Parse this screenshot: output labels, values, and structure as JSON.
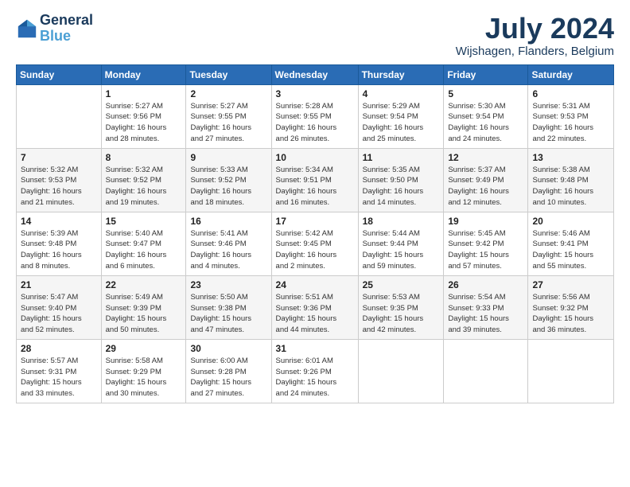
{
  "header": {
    "logo_line1": "General",
    "logo_line2": "Blue",
    "month_year": "July 2024",
    "location": "Wijshagen, Flanders, Belgium"
  },
  "weekdays": [
    "Sunday",
    "Monday",
    "Tuesday",
    "Wednesday",
    "Thursday",
    "Friday",
    "Saturday"
  ],
  "weeks": [
    [
      {
        "day": "",
        "info": ""
      },
      {
        "day": "1",
        "info": "Sunrise: 5:27 AM\nSunset: 9:56 PM\nDaylight: 16 hours\nand 28 minutes."
      },
      {
        "day": "2",
        "info": "Sunrise: 5:27 AM\nSunset: 9:55 PM\nDaylight: 16 hours\nand 27 minutes."
      },
      {
        "day": "3",
        "info": "Sunrise: 5:28 AM\nSunset: 9:55 PM\nDaylight: 16 hours\nand 26 minutes."
      },
      {
        "day": "4",
        "info": "Sunrise: 5:29 AM\nSunset: 9:54 PM\nDaylight: 16 hours\nand 25 minutes."
      },
      {
        "day": "5",
        "info": "Sunrise: 5:30 AM\nSunset: 9:54 PM\nDaylight: 16 hours\nand 24 minutes."
      },
      {
        "day": "6",
        "info": "Sunrise: 5:31 AM\nSunset: 9:53 PM\nDaylight: 16 hours\nand 22 minutes."
      }
    ],
    [
      {
        "day": "7",
        "info": "Sunrise: 5:32 AM\nSunset: 9:53 PM\nDaylight: 16 hours\nand 21 minutes."
      },
      {
        "day": "8",
        "info": "Sunrise: 5:32 AM\nSunset: 9:52 PM\nDaylight: 16 hours\nand 19 minutes."
      },
      {
        "day": "9",
        "info": "Sunrise: 5:33 AM\nSunset: 9:52 PM\nDaylight: 16 hours\nand 18 minutes."
      },
      {
        "day": "10",
        "info": "Sunrise: 5:34 AM\nSunset: 9:51 PM\nDaylight: 16 hours\nand 16 minutes."
      },
      {
        "day": "11",
        "info": "Sunrise: 5:35 AM\nSunset: 9:50 PM\nDaylight: 16 hours\nand 14 minutes."
      },
      {
        "day": "12",
        "info": "Sunrise: 5:37 AM\nSunset: 9:49 PM\nDaylight: 16 hours\nand 12 minutes."
      },
      {
        "day": "13",
        "info": "Sunrise: 5:38 AM\nSunset: 9:48 PM\nDaylight: 16 hours\nand 10 minutes."
      }
    ],
    [
      {
        "day": "14",
        "info": "Sunrise: 5:39 AM\nSunset: 9:48 PM\nDaylight: 16 hours\nand 8 minutes."
      },
      {
        "day": "15",
        "info": "Sunrise: 5:40 AM\nSunset: 9:47 PM\nDaylight: 16 hours\nand 6 minutes."
      },
      {
        "day": "16",
        "info": "Sunrise: 5:41 AM\nSunset: 9:46 PM\nDaylight: 16 hours\nand 4 minutes."
      },
      {
        "day": "17",
        "info": "Sunrise: 5:42 AM\nSunset: 9:45 PM\nDaylight: 16 hours\nand 2 minutes."
      },
      {
        "day": "18",
        "info": "Sunrise: 5:44 AM\nSunset: 9:44 PM\nDaylight: 15 hours\nand 59 minutes."
      },
      {
        "day": "19",
        "info": "Sunrise: 5:45 AM\nSunset: 9:42 PM\nDaylight: 15 hours\nand 57 minutes."
      },
      {
        "day": "20",
        "info": "Sunrise: 5:46 AM\nSunset: 9:41 PM\nDaylight: 15 hours\nand 55 minutes."
      }
    ],
    [
      {
        "day": "21",
        "info": "Sunrise: 5:47 AM\nSunset: 9:40 PM\nDaylight: 15 hours\nand 52 minutes."
      },
      {
        "day": "22",
        "info": "Sunrise: 5:49 AM\nSunset: 9:39 PM\nDaylight: 15 hours\nand 50 minutes."
      },
      {
        "day": "23",
        "info": "Sunrise: 5:50 AM\nSunset: 9:38 PM\nDaylight: 15 hours\nand 47 minutes."
      },
      {
        "day": "24",
        "info": "Sunrise: 5:51 AM\nSunset: 9:36 PM\nDaylight: 15 hours\nand 44 minutes."
      },
      {
        "day": "25",
        "info": "Sunrise: 5:53 AM\nSunset: 9:35 PM\nDaylight: 15 hours\nand 42 minutes."
      },
      {
        "day": "26",
        "info": "Sunrise: 5:54 AM\nSunset: 9:33 PM\nDaylight: 15 hours\nand 39 minutes."
      },
      {
        "day": "27",
        "info": "Sunrise: 5:56 AM\nSunset: 9:32 PM\nDaylight: 15 hours\nand 36 minutes."
      }
    ],
    [
      {
        "day": "28",
        "info": "Sunrise: 5:57 AM\nSunset: 9:31 PM\nDaylight: 15 hours\nand 33 minutes."
      },
      {
        "day": "29",
        "info": "Sunrise: 5:58 AM\nSunset: 9:29 PM\nDaylight: 15 hours\nand 30 minutes."
      },
      {
        "day": "30",
        "info": "Sunrise: 6:00 AM\nSunset: 9:28 PM\nDaylight: 15 hours\nand 27 minutes."
      },
      {
        "day": "31",
        "info": "Sunrise: 6:01 AM\nSunset: 9:26 PM\nDaylight: 15 hours\nand 24 minutes."
      },
      {
        "day": "",
        "info": ""
      },
      {
        "day": "",
        "info": ""
      },
      {
        "day": "",
        "info": ""
      }
    ]
  ]
}
